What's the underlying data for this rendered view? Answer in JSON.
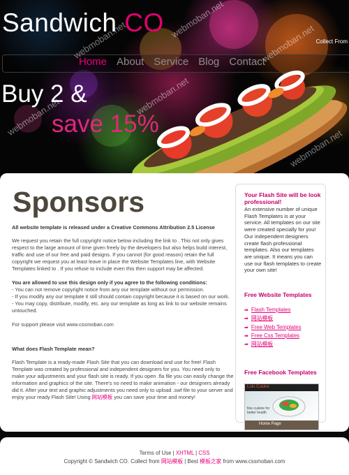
{
  "header": {
    "logo_part1": "Sandwich",
    "logo_part2": "CO",
    "collect_text": "Collect From",
    "watermark": "webmoban.net",
    "promo_line1": "Buy 2 &",
    "promo_line2": "save 15%"
  },
  "nav": {
    "items": [
      {
        "label": "Home"
      },
      {
        "label": "About"
      },
      {
        "label": "Service"
      },
      {
        "label": "Blog"
      },
      {
        "label": "Contact"
      }
    ]
  },
  "main": {
    "title": "Sponsors",
    "license_heading": "All website template is released under a Creative Commons Attribution 2.5 License",
    "license_text": "We request you retain the full copyright notice below including the link to . This not only gives respect to the large amount of time given freely by the developers but also helps build interest, traffic and use of our free and paid designs. If you cannot (for good reason) retain the full copyright we request you at least leave in place the Website Templates line, with Website Templates linked to . If you refuse to include even this then support may be affected.",
    "conditions_heading": "You are allowed to use this design only if you agree to the following conditions:",
    "conditions": [
      "- You can not remove copyright notice from any our template without our permission.",
      "- If you modify any our template it still should contain copyright because it is based on our work.",
      "- You may copy, distribute, modify, etc. any our template as long as link to our website remains untouched."
    ],
    "support_text": "For support please visit www.cssmoban.com",
    "flash_heading": "What does Flash Template mean?",
    "flash_text_before_link": "Flash Template is a ready-made Flash Site that you can download and use for free! Flash Template was created by professional and independent designers for you. You need only to make your adjustments and your flash site is ready. If you open .fla file you can easily change the information and graphics of the site. There's no need to make animation - our designers already did it. After your text and graphic adjustments you need only to upload .swf file to your server and enjoy your ready Flash Site! Using ",
    "flash_link": "网站模板",
    "flash_text_after_link": " you can save your time and money!"
  },
  "sidebar": {
    "promo_heading": "Your Flash Site will be look professional!",
    "promo_text": "An extensive number of unique Flash Templates is at your service. All templates on our site were created specially for you! Our independent designers create flash professional templates. Also our templates are unique. It means you can use our flash templates to create your own site!",
    "links_heading": "Free Website Templates",
    "links": [
      {
        "label": "Flash Templates"
      },
      {
        "label": "网站模板"
      },
      {
        "label": "Free Web Templates"
      },
      {
        "label": "Free Css Templates"
      },
      {
        "label": "网站模板"
      }
    ],
    "facebook_heading": "Free Facebook Templates",
    "facebook_widget": {
      "brand": "Lulu Cusine",
      "tagline": "fine cuisine for better health",
      "button": "Home Page"
    }
  },
  "footer": {
    "terms": "Terms of Use",
    "sep1": " | ",
    "xhtml": "XHTML",
    "sep2": " | ",
    "css": "CSS",
    "copyright": "Copyright © Sandwich CO. Collect from ",
    "link1": "网站模板",
    "sep3": " | Best ",
    "link2": "模板之家",
    "from_text": " from www.cssmoban.com"
  },
  "colors": {
    "accent": "#e6007a",
    "background": "#0a0a0a",
    "title_brown": "#4d473c"
  },
  "icons": {
    "list_bullet": "arrow-right-icon"
  }
}
